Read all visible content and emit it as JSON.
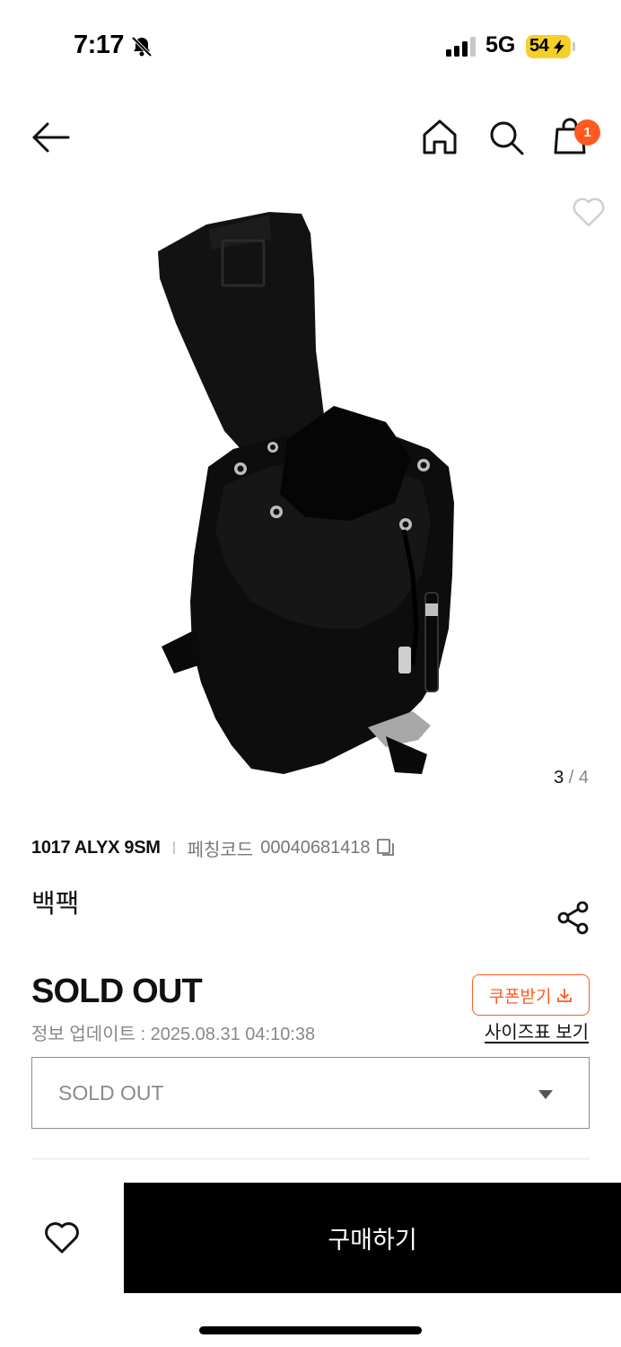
{
  "status_bar": {
    "time": "7:17",
    "network": "5G",
    "battery": "54",
    "icons": [
      "bell-off-icon",
      "signal-icon",
      "battery-charging-icon"
    ]
  },
  "header": {
    "icons": [
      "back-arrow-icon",
      "home-icon",
      "search-icon",
      "shopping-bag-icon"
    ],
    "cart_count": "1",
    "badge_color": "#ff5a1f"
  },
  "gallery": {
    "current": "3",
    "total": "4",
    "divider": "/",
    "image_subject": "black nylon drawstring backpack"
  },
  "product": {
    "brand": "1017 ALYX 9SM",
    "code_label": "페칭코드",
    "code": "00040681418",
    "name": "백팩",
    "status": "SOLD OUT",
    "update_info": "정보 업데이트 : 2025.08.31 04:10:38"
  },
  "actions": {
    "coupon_label": "쿠폰받기",
    "size_chart_label": "사이즈표 보기",
    "option_value": "SOLD OUT",
    "buy_label": "구매하기"
  },
  "colors": {
    "accent": "#ff5a1f",
    "buy_button": "#000000",
    "text_muted": "#888888"
  }
}
